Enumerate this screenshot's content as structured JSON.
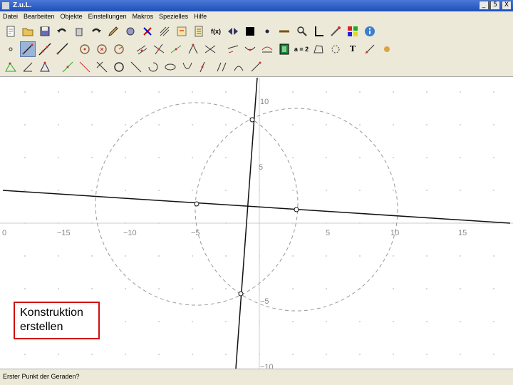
{
  "window": {
    "title": "Z.u.L."
  },
  "menu": [
    "Datei",
    "Bearbeiten",
    "Objekte",
    "Einstellungen",
    "Makros",
    "Spezielles",
    "Hilfe"
  ],
  "window_buttons": {
    "minimize": "_",
    "maximize": "5",
    "close": "X"
  },
  "toolbar": {
    "rows": [
      [
        "new-file-icon",
        "open-file-icon",
        "save-file-icon",
        "undo-icon",
        "delete-icon",
        "redo-icon",
        "edit-icon",
        "properties-icon",
        "color-icon",
        "grid-icon",
        "macro-icon",
        "text-icon",
        "f(x)",
        "animate-icon",
        "fill-icon",
        "point-icon",
        "line-style-icon",
        "zoom-icon",
        "coordinates-icon",
        "settings-icon",
        "colors-icon",
        "info-icon"
      ],
      [
        "point-tool",
        "segment-tool",
        "line-tool",
        "ray-tool",
        "circle-tool",
        "circle2-tool",
        "compass-tool",
        "parallel-tool",
        "perpendicular-tool",
        "midpoint-tool",
        "angle-tool",
        "intersect-tool",
        "move-tool",
        "hide-tool",
        "expression-tool",
        "a = 2",
        "polygon-tool",
        "arc-tool",
        "T",
        "function-tool",
        "track-tool"
      ],
      [
        "triangle-tool",
        "angle2-tool",
        "polygon2-tool",
        "bisector-tool",
        "reflect-tool",
        "rotate-tool",
        "circle3-tool",
        "tangent-tool",
        "sector-tool",
        "ellipse-tool",
        "parabola-tool",
        "locus-tool",
        "transform-tool",
        "locus2-tool",
        "vector-tool"
      ]
    ]
  },
  "coordinate_system": {
    "x_ticks": [
      "0",
      "−15",
      "−10",
      "−5",
      "5",
      "10",
      "15"
    ],
    "y_ticks": [
      "10",
      "5",
      "−5",
      "−10"
    ]
  },
  "info_box": {
    "line1": "Konstruktion",
    "line2": "erstellen"
  },
  "status": {
    "text": "Erster Punkt der Geraden?"
  },
  "colors": {
    "accent": "#d01010",
    "titlebar": "#2358c4",
    "chrome": "#ece9d8"
  }
}
